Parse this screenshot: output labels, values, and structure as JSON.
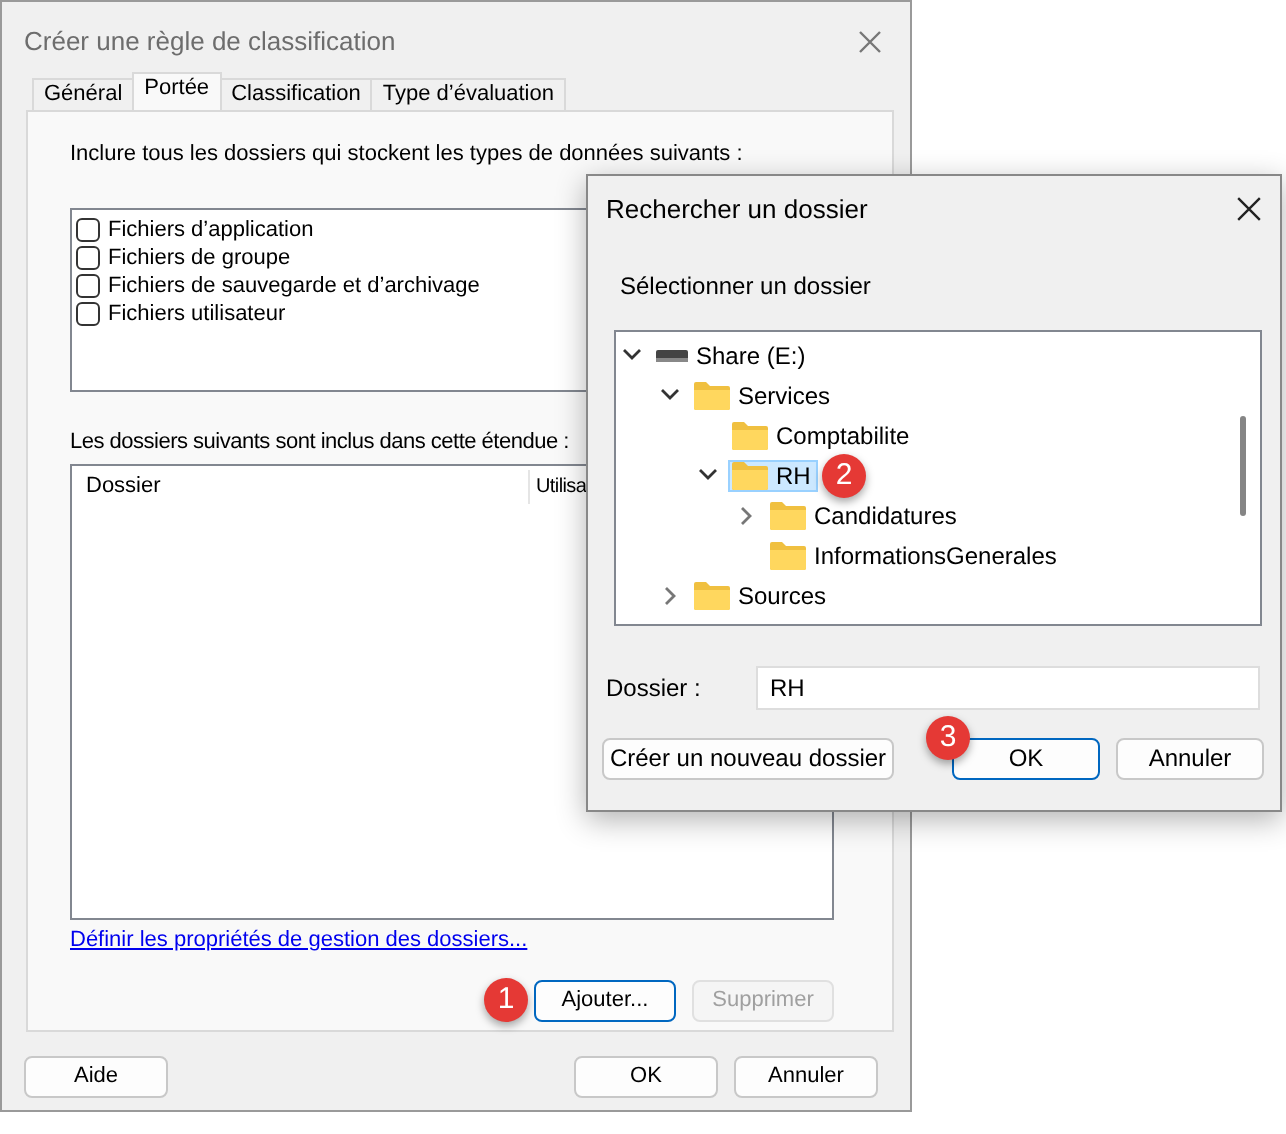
{
  "main_window": {
    "title": "Créer une règle de classification",
    "tabs": [
      {
        "label": "Général",
        "selected": false
      },
      {
        "label": "Portée",
        "selected": true
      },
      {
        "label": "Classification",
        "selected": false
      },
      {
        "label": "Type d’évaluation",
        "selected": false
      }
    ],
    "intro": "Inclure tous les dossiers qui stockent les types de données suivants :",
    "file_types": [
      {
        "label": "Fichiers d’application",
        "checked": false
      },
      {
        "label": "Fichiers de groupe",
        "checked": false
      },
      {
        "label": "Fichiers de sauvegarde et d’archivage",
        "checked": false
      },
      {
        "label": "Fichiers utilisateur",
        "checked": false
      }
    ],
    "folders_label": "Les dossiers suivants sont inclus dans cette étendue :",
    "folders_table": {
      "columns": [
        "Dossier",
        "Utilisa"
      ]
    },
    "link": "Définir les propriétés de gestion des dossiers...",
    "buttons": [
      {
        "label": "Ajouter...",
        "disabled": false,
        "focused": true
      },
      {
        "label": "Supprimer",
        "disabled": true,
        "focused": false
      }
    ],
    "footer_buttons": [
      {
        "label": "Aide"
      },
      {
        "label": "OK"
      },
      {
        "label": "Annuler"
      }
    ]
  },
  "browse_dialog": {
    "title": "Rechercher un dossier",
    "prompt": "Sélectionner un dossier",
    "tree": [
      {
        "label": "Share (E:)",
        "kind": "drive",
        "expanded": true,
        "selected": false,
        "children": [
          {
            "label": "Services",
            "kind": "folder",
            "expanded": true,
            "selected": false,
            "children": [
              {
                "label": "Comptabilite",
                "kind": "folder",
                "selected": false
              },
              {
                "label": "RH",
                "kind": "folder",
                "expanded": true,
                "selected": true,
                "children": [
                  {
                    "label": "Candidatures",
                    "kind": "folder",
                    "expanded": false,
                    "selected": false
                  },
                  {
                    "label": "InformationsGenerales",
                    "kind": "folder",
                    "selected": false
                  }
                ]
              }
            ]
          },
          {
            "label": "Sources",
            "kind": "folder",
            "expanded": false,
            "selected": false
          }
        ]
      }
    ],
    "folder_label": "Dossier :",
    "folder_value": "RH",
    "buttons": [
      {
        "label": "Créer un nouveau dossier",
        "focused": false
      },
      {
        "label": "OK",
        "focused": true
      },
      {
        "label": "Annuler",
        "focused": false
      }
    ]
  },
  "step_badges": [
    {
      "label": "1"
    },
    {
      "label": "2"
    },
    {
      "label": "3"
    }
  ]
}
